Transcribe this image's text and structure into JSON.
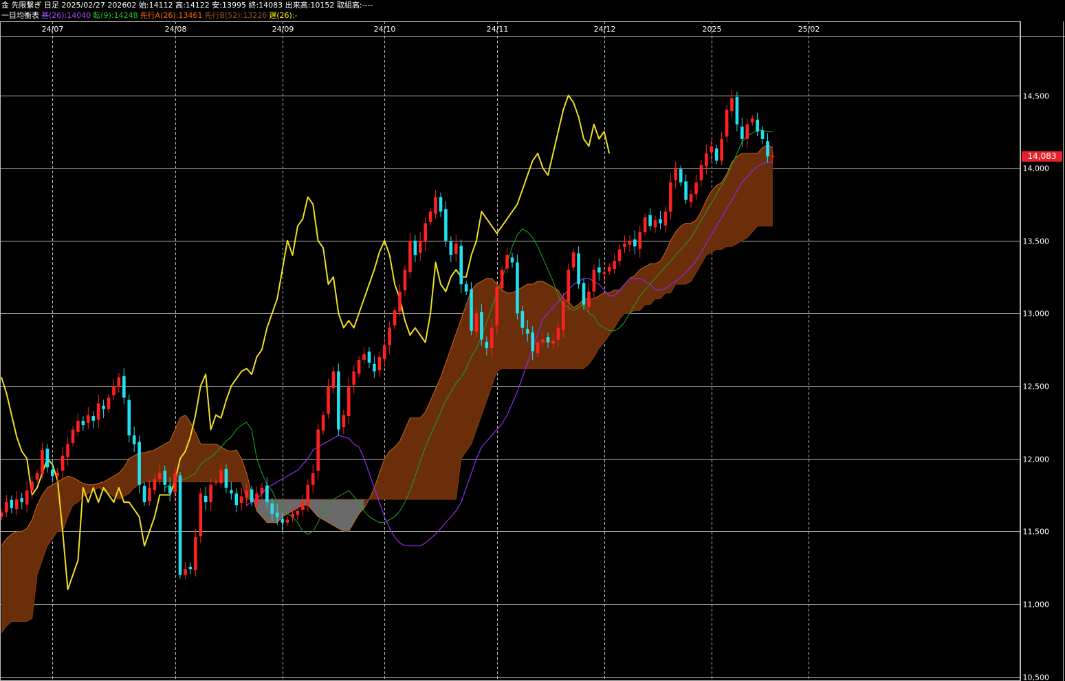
{
  "header": {
    "line1": "金 先限繋ぎ 日足 2025/02/27 202602 始:14112 高:14122 安:13995 終:14083 出来高:10152 取組高:----",
    "line2": [
      {
        "text": "一目均衡表",
        "color": "#ffffff"
      },
      {
        "text": "基(26):14040",
        "color": "#a050ff"
      },
      {
        "text": "転(9):14248",
        "color": "#22cc22"
      },
      {
        "text": "先行A(26):13461",
        "color": "#ff6a00"
      },
      {
        "text": "先行B(52):13226",
        "color": "#a0522d"
      },
      {
        "text": "遅(26):-",
        "color": "#ffee00"
      }
    ]
  },
  "colors": {
    "background": "#000000",
    "grid": "#bbbbbb",
    "up_candle": "#ff2020",
    "down_candle": "#22e0f0",
    "kijun": "#8a2be2",
    "tenkan": "#1e9e1e",
    "chikou": "#f0e020",
    "cloud_bull": "#6b2e0a",
    "cloud_bull_edge": "#c86a20",
    "cloud_bear": "#6a6a6a",
    "last_price_bg": "#e8202a"
  },
  "chart_data": {
    "type": "candlestick-ichimoku",
    "x_labels": [
      {
        "label": "24/07",
        "idx": 10
      },
      {
        "label": "24/08",
        "idx": 34
      },
      {
        "label": "24/09",
        "idx": 55
      },
      {
        "label": "24/10",
        "idx": 75
      },
      {
        "label": "24/11",
        "idx": 97
      },
      {
        "label": "24/12",
        "idx": 118
      },
      {
        "label": "2025",
        "idx": 139
      },
      {
        "label": "25/02",
        "idx": 158
      }
    ],
    "y_ticks": [
      {
        "value": 14500,
        "label": "14,500"
      },
      {
        "value": 14000,
        "label": "14,000"
      },
      {
        "value": 13500,
        "label": "13,500"
      },
      {
        "value": 13000,
        "label": "13,000"
      },
      {
        "value": 12500,
        "label": "12,500"
      },
      {
        "value": 12000,
        "label": "12,000"
      },
      {
        "value": 11500,
        "label": "11,500"
      },
      {
        "value": 11000,
        "label": "11,000"
      },
      {
        "value": 10500,
        "label": "10,500"
      }
    ],
    "ylim": [
      10470,
      14900
    ],
    "last_price": 14083,
    "last_price_label": "14,083",
    "close": [
      11630,
      11700,
      11660,
      11720,
      11700,
      11780,
      11840,
      11900,
      12060,
      11940,
      11880,
      11900,
      12020,
      12100,
      12200,
      12260,
      12230,
      12300,
      12260,
      12380,
      12340,
      12420,
      12500,
      12560,
      12420,
      12160,
      12100,
      11820,
      11700,
      11800,
      11860,
      11900,
      11820,
      11760,
      11900,
      11200,
      11240,
      11240,
      11460,
      11760,
      11700,
      11820,
      11840,
      11920,
      11800,
      11760,
      11680,
      11740,
      11780,
      11700,
      11760,
      11800,
      11700,
      11620,
      11600,
      11560,
      11580,
      11620,
      11640,
      11700,
      11820,
      11900,
      12200,
      12300,
      12500,
      12600,
      12200,
      12300,
      12500,
      12600,
      12680,
      12720,
      12660,
      12600,
      12700,
      12780,
      12900,
      13020,
      13150,
      13300,
      13500,
      13400,
      13500,
      13620,
      13700,
      13800,
      13700,
      13500,
      13400,
      13480,
      13200,
      13150,
      12880,
      13000,
      12820,
      12760,
      12900,
      13180,
      13300,
      13400,
      13350,
      13000,
      12900,
      12860,
      12740,
      12800,
      12820,
      12800,
      12810,
      12900,
      13080,
      13300,
      13420,
      13200,
      13060,
      13150,
      13300,
      13280,
      13280,
      13320,
      13360,
      13440,
      13480,
      13500,
      13460,
      13560,
      13660,
      13600,
      13640,
      13620,
      13700,
      13900,
      14000,
      13900,
      13780,
      13820,
      13900,
      14020,
      14100,
      14150,
      14050,
      14200,
      14400,
      14480,
      14300,
      14200,
      14300,
      14340,
      14250,
      14200,
      14080,
      14083
    ],
    "tenkan": [
      11800,
      11820,
      11840,
      11850,
      11860,
      11880,
      11900,
      11960,
      11990,
      12010,
      12040,
      12080,
      12120,
      12150,
      12200,
      12230,
      12250,
      12200,
      12000,
      11900,
      11820,
      11780,
      11700,
      11660,
      11620,
      11600,
      11560,
      11500,
      11480,
      11500,
      11560,
      11640,
      11700,
      11720,
      11740,
      11760,
      11780,
      11740,
      11700,
      11640,
      11600,
      11580,
      11560,
      11560,
      11580,
      11600,
      11640,
      11700,
      11780,
      11880,
      11980,
      12080,
      12160,
      12240,
      12320,
      12400,
      12460,
      12520,
      12560,
      12620,
      12700,
      12760,
      12840,
      12940,
      13040,
      13140,
      13240,
      13340,
      13460,
      13540,
      13580,
      13560,
      13520,
      13460,
      13380,
      13300,
      13220,
      13120,
      13060,
      13040,
      13020,
      13040,
      13060,
      13000,
      12980,
      12920,
      12900,
      12880,
      12880,
      12900,
      12940,
      13000,
      13060,
      13120,
      13160,
      13200,
      13240,
      13280,
      13320,
      13360,
      13400,
      13440,
      13480,
      13520,
      13580,
      13640,
      13700,
      13760,
      13820,
      13880,
      13940,
      14020,
      14100,
      14180,
      14220,
      14240,
      14260,
      14260,
      14250,
      14248
    ],
    "kijun": [
      11680,
      11700,
      11720,
      11760,
      11800,
      11820,
      11840,
      11860,
      11880,
      11900,
      11920,
      11960,
      12000,
      12060,
      12080,
      12100,
      12120,
      12140,
      12160,
      12150,
      12140,
      12100,
      12080,
      12000,
      11900,
      11800,
      11700,
      11600,
      11520,
      11460,
      11420,
      11400,
      11400,
      11400,
      11400,
      11420,
      11450,
      11480,
      11520,
      11560,
      11600,
      11640,
      11700,
      11800,
      11900,
      12000,
      12080,
      12120,
      12160,
      12200,
      12240,
      12300,
      12380,
      12460,
      12560,
      12660,
      12760,
      12860,
      12960,
      13000,
      13040,
      13080,
      13120,
      13160,
      13200,
      13220,
      13240,
      13240,
      13220,
      13200,
      13160,
      13120,
      13120,
      13160,
      13200,
      13240,
      13240,
      13240,
      13220,
      13200,
      13160,
      13160,
      13170,
      13200,
      13220,
      13250,
      13280,
      13320,
      13360,
      13420,
      13480,
      13540,
      13600,
      13660,
      13720,
      13780,
      13840,
      13900,
      13940,
      13980,
      14010,
      14030,
      14040,
      14040
    ],
    "chikou": [
      12560,
      12450,
      12300,
      12150,
      12050,
      12000,
      11750,
      11800,
      11900,
      12000,
      11960,
      11850,
      11500,
      11100,
      11200,
      11300,
      11800,
      11700,
      11800,
      11700,
      11800,
      11750,
      11700,
      11800,
      11700,
      11700,
      11650,
      11600,
      11400,
      11500,
      11600,
      11750,
      11750,
      11750,
      11850,
      12000,
      12050,
      12150,
      12300,
      12500,
      12580,
      12200,
      12300,
      12280,
      12400,
      12500,
      12550,
      12600,
      12620,
      12580,
      12700,
      12750,
      12900,
      13000,
      13100,
      13300,
      13500,
      13400,
      13600,
      13650,
      13800,
      13750,
      13500,
      13450,
      13200,
      13250,
      13000,
      12900,
      12950,
      12900,
      13000,
      13100,
      13200,
      13300,
      13420,
      13500,
      13400,
      13200,
      13100,
      12950,
      12850,
      12900,
      12850,
      12800,
      13000,
      13350,
      13200,
      13150,
      13250,
      13300,
      13250,
      13250,
      13400,
      13500,
      13700,
      13650,
      13600,
      13550,
      13600,
      13650,
      13700,
      13750,
      13850,
      13950,
      14050,
      14100,
      14000,
      13950,
      14100,
      14250,
      14400,
      14500,
      14450,
      14350,
      14200,
      14150,
      14300,
      14200,
      14250,
      14100
    ],
    "span_a": [
      11400,
      11450,
      11480,
      11500,
      11500,
      11520,
      11580,
      11680,
      11750,
      11800,
      11820,
      11840,
      11860,
      11880,
      11870,
      11850,
      11830,
      11820,
      11820,
      11830,
      11840,
      11860,
      11880,
      11900,
      11940,
      12000,
      12020,
      12040,
      12040,
      12050,
      12060,
      12080,
      12100,
      12120,
      12200,
      12280,
      12300,
      12250,
      12180,
      12100,
      12100,
      12100,
      12100,
      12080,
      12060,
      12050,
      12060,
      12000,
      11900,
      11760,
      11640,
      11600,
      11560,
      11560,
      11560,
      11600,
      11620,
      11640,
      11660,
      11680,
      11680,
      11640,
      11600,
      11580,
      11560,
      11540,
      11520,
      11500,
      11500,
      11560,
      11620,
      11660,
      11720,
      11800,
      11900,
      12000,
      12050,
      12080,
      12120,
      12200,
      12280,
      12280,
      12280,
      12320,
      12400,
      12480,
      12560,
      12660,
      12760,
      12860,
      12960,
      13060,
      13160,
      13200,
      13220,
      13240,
      13240,
      13200,
      13160,
      13140,
      13140,
      13160,
      13180,
      13200,
      13200,
      13220,
      13220,
      13200,
      13180,
      13160,
      13100,
      13080,
      13040,
      13060,
      13100,
      13100,
      13100,
      13120,
      13140,
      13140,
      13160,
      13160,
      13200,
      13240,
      13260,
      13300,
      13320,
      13340,
      13340,
      13360,
      13420,
      13500,
      13560,
      13600,
      13620,
      13620,
      13640,
      13700,
      13780,
      13840,
      13880,
      13900,
      13960,
      14040,
      14080,
      14100,
      14100,
      14100,
      14100,
      14140,
      14160,
      14140
    ],
    "span_b": [
      10800,
      10850,
      10880,
      10880,
      10880,
      10880,
      10900,
      11200,
      11300,
      11400,
      11450,
      11500,
      11500,
      11600,
      11680,
      11700,
      11740,
      11760,
      11780,
      11800,
      11780,
      11760,
      11740,
      11720,
      11740,
      11760,
      11800,
      11820,
      11840,
      11840,
      11840,
      11840,
      11840,
      11840,
      11840,
      11840,
      11840,
      11840,
      11840,
      11840,
      11840,
      11840,
      11840,
      11840,
      11840,
      11840,
      11840,
      11840,
      11720,
      11720,
      11720,
      11720,
      11720,
      11720,
      11720,
      11720,
      11720,
      11720,
      11720,
      11720,
      11720,
      11720,
      11720,
      11720,
      11720,
      11720,
      11720,
      11720,
      11720,
      11720,
      11720,
      11720,
      11720,
      11720,
      11720,
      11720,
      11720,
      11720,
      11720,
      11720,
      11720,
      11720,
      11720,
      11720,
      11720,
      11720,
      11720,
      11720,
      11720,
      11720,
      12000,
      12050,
      12100,
      12200,
      12300,
      12400,
      12500,
      12600,
      12620,
      12620,
      12620,
      12620,
      12620,
      12620,
      12620,
      12620,
      12620,
      12620,
      12620,
      12620,
      12620,
      12620,
      12620,
      12620,
      12620,
      12650,
      12700,
      12760,
      12800,
      12850,
      12900,
      12960,
      13000,
      13000,
      13020,
      13020,
      13060,
      13060,
      13100,
      13100,
      13140,
      13140,
      13200,
      13200,
      13200,
      13220,
      13280,
      13340,
      13400,
      13420,
      13440,
      13440,
      13460,
      13460,
      13480,
      13500,
      13520,
      13560,
      13600,
      13600,
      13600,
      13600,
      13600,
      13600,
      13600,
      13600
    ]
  }
}
